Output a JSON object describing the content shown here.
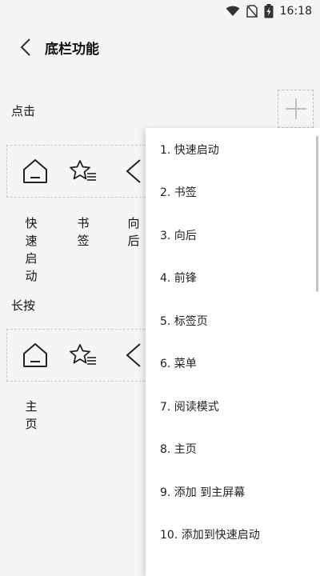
{
  "status": {
    "time": "16:18"
  },
  "header": {
    "title": "底栏功能"
  },
  "sections": {
    "click_label": "点击",
    "long_press_label": "长按"
  },
  "click_slots": [
    {
      "icon": "home-icon",
      "label": "快速启动"
    },
    {
      "icon": "star-bookmark-icon",
      "label": "书签"
    },
    {
      "icon": "back-arrow-icon",
      "label": "向后"
    }
  ],
  "long_press_slots": [
    {
      "icon": "home-icon",
      "label": "主页"
    },
    {
      "icon": "star-bookmark-icon",
      "label": ""
    },
    {
      "icon": "back-arrow-icon",
      "label": ""
    }
  ],
  "menu": {
    "items": [
      "1. 快速启动",
      "2. 书签",
      "3. 向后",
      "4. 前锋",
      "5. 标签页",
      "6. 菜单",
      "7. 阅读模式",
      "8. 主页",
      "9. 添加 到主屏幕",
      "10. 添加到快速启动"
    ]
  }
}
